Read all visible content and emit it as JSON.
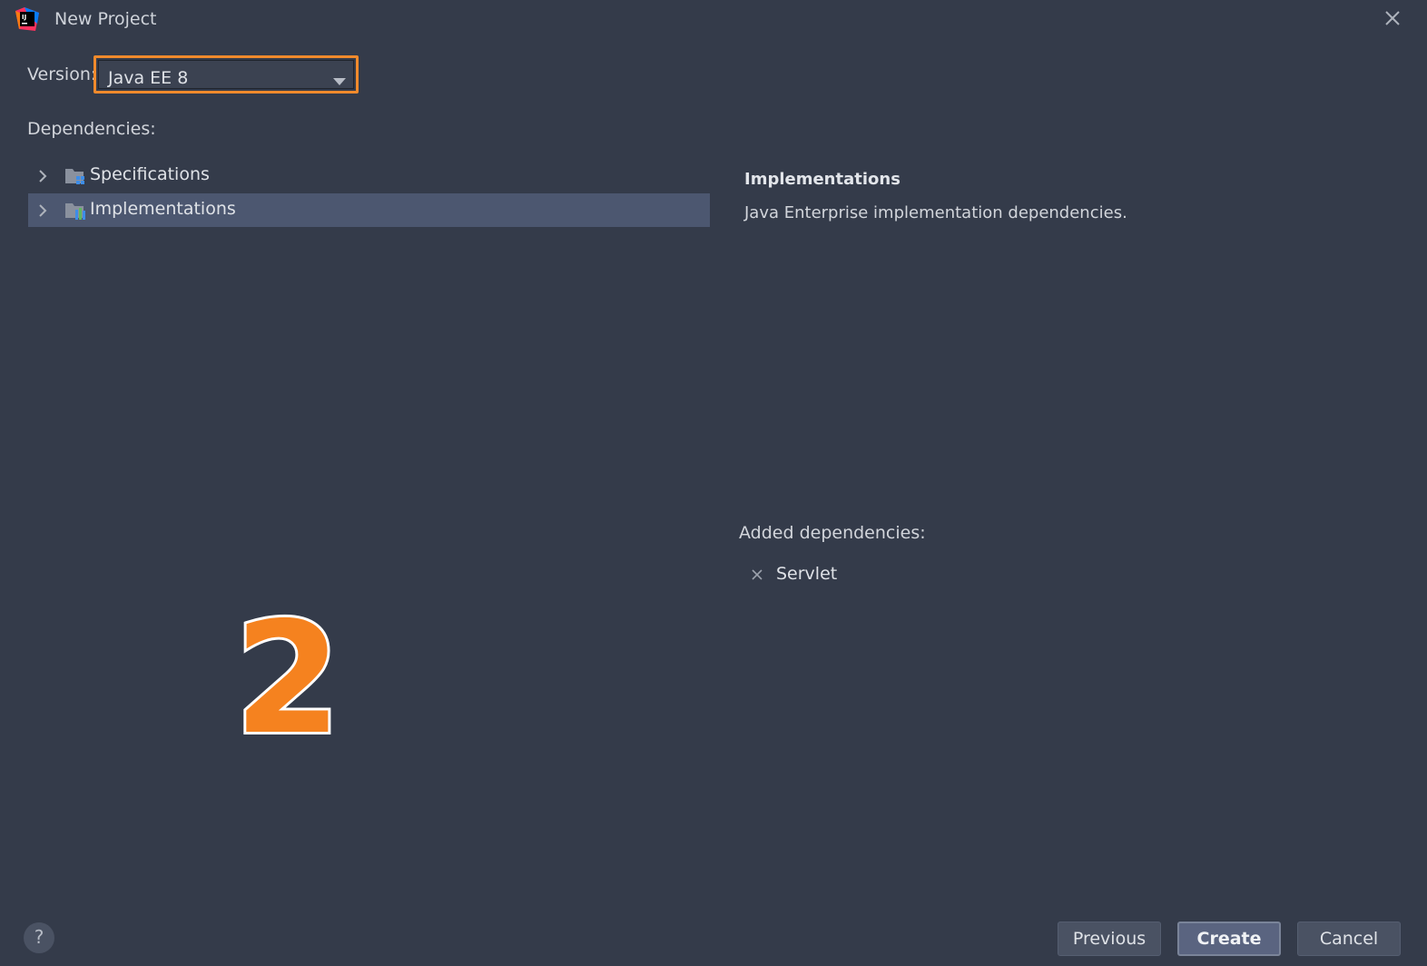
{
  "window": {
    "title": "New Project",
    "logo_text": "IJ"
  },
  "version": {
    "label": "Version:",
    "selected": "Java EE 8",
    "highlight_color": "#f08a2c"
  },
  "dependencies": {
    "label": "Dependencies:",
    "tree": [
      {
        "label": "Specifications",
        "selected": false
      },
      {
        "label": "Implementations",
        "selected": true
      }
    ]
  },
  "detail": {
    "title": "Implementations",
    "description": "Java Enterprise implementation dependencies."
  },
  "added": {
    "label": "Added dependencies:",
    "items": [
      "Servlet"
    ]
  },
  "annotation": {
    "step": "2",
    "color": "#f5821f"
  },
  "footer": {
    "help": "?",
    "previous": "Previous",
    "create": "Create",
    "cancel": "Cancel"
  }
}
